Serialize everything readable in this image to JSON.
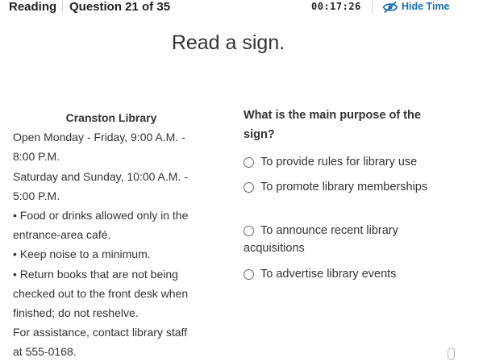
{
  "header": {
    "section": "Reading",
    "question_counter": "Question 21 of 35",
    "timer": "00:17:26",
    "hide_time_label": "Hide Time",
    "hide_time_icon": "eye-slash-icon",
    "accent_color": "#1a6db3"
  },
  "page_title": "Read a sign.",
  "sign": {
    "title": "Cranston Library",
    "lines": [
      "Open Monday - Friday, 9:00 A.M. -",
      "8:00 P.M.",
      "Saturday and Sunday, 10:00 A.M. -",
      "5:00 P.M.",
      "• Food or drinks allowed only in the",
      "entrance-area café.",
      "• Keep noise to a minimum.",
      "• Return books that are not being",
      "checked out to the front desk when",
      "finished; do not reshelve.",
      "For assistance, contact library staff",
      "at 555-0168."
    ]
  },
  "question": {
    "prompt": "What is the main purpose of the sign?",
    "options": [
      {
        "label": "To provide rules for library use"
      },
      {
        "label": "To promote library memberships"
      },
      {
        "label": "To announce recent library acquisitions"
      },
      {
        "label": "To advertise library events"
      }
    ]
  }
}
